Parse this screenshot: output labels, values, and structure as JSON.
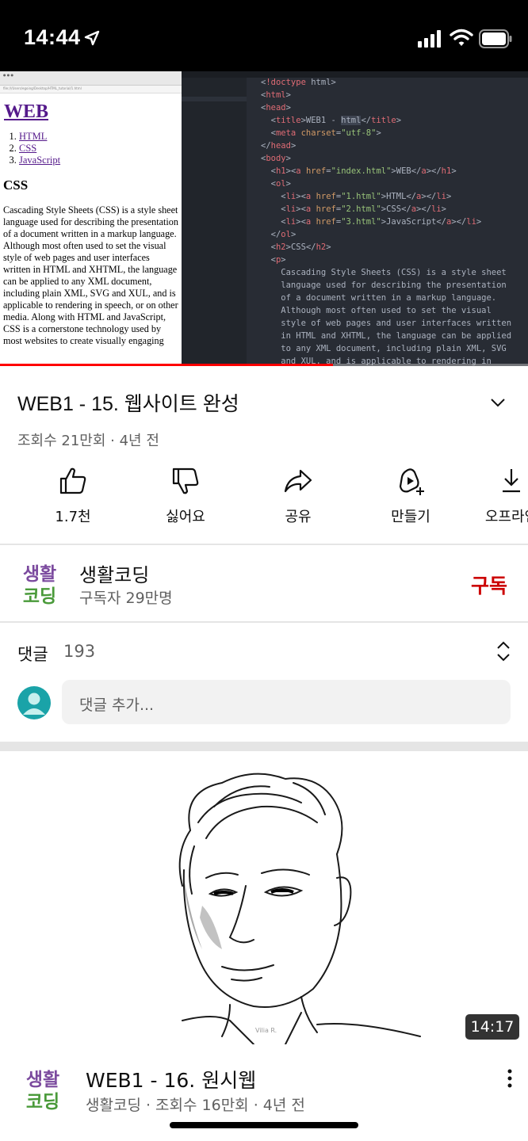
{
  "status_bar": {
    "time": "14:44",
    "icons": [
      "location-arrow-icon",
      "signal-icon",
      "wifi-icon",
      "battery-icon"
    ]
  },
  "video": {
    "browser": {
      "address": "file:///Users/egoing/Desktop/HTML_tutorial/1.html",
      "h1": "WEB",
      "links": [
        "HTML",
        "CSS",
        "JavaScript"
      ],
      "h2": "CSS",
      "paragraph": "Cascading Style Sheets (CSS) is a style sheet language used for describing the presentation of a document written in a markup language. Although most often used to set the visual style of web pages and user interfaces written in HTML and XHTML, the language can be applied to any XML document, including plain XML, SVG and XUL, and is applicable to rendering in speech, or on other media. Along with HTML and JavaScript, CSS is a cornerstone technology used by most websites to create visually engaging"
    },
    "editor_lines": [
      "<!doctype html>",
      "<html>",
      "<head>",
      "  <title>WEB1 - html</title>",
      "  <meta charset=\"utf-8\">",
      "</head>",
      "<body>",
      "  <h1><a href=\"index.html\">WEB</a></h1>",
      "  <ol>",
      "    <li><a href=\"1.html\">HTML</a></li>",
      "    <li><a href=\"2.html\">CSS</a></li>",
      "    <li><a href=\"3.html\">JavaScript</a></li>",
      "  </ol>",
      "  <h2>CSS</h2>",
      "  <p>",
      "    Cascading Style Sheets (CSS) is a style sheet",
      "    language used for describing the presentation",
      "    of a document written in a markup language.",
      "    Although most often used to set the visual",
      "    style of web pages and user interfaces written",
      "    in HTML and XHTML, the language can be applied",
      "    to any XML document, including plain XML, SVG",
      "    and XUL, and is applicable to rendering in"
    ],
    "progress_fraction": 0.63
  },
  "title": {
    "text": "WEB1 - 15. 웹사이트 완성",
    "meta": "조회수 21만회 · 4년 전"
  },
  "actions": [
    {
      "label": "1.7천",
      "icon": "thumbs-up-icon"
    },
    {
      "label": "싫어요",
      "icon": "thumbs-down-icon"
    },
    {
      "label": "공유",
      "icon": "share-icon"
    },
    {
      "label": "만들기",
      "icon": "remix-icon"
    },
    {
      "label": "오프라인",
      "icon": "download-icon"
    }
  ],
  "channel": {
    "name": "생활코딩",
    "subscribers": "구독자 29만명",
    "subscribe_label": "구독",
    "logo_text_top": "생활",
    "logo_text_bottom": "코딩"
  },
  "comments": {
    "label": "댓글",
    "count": "193",
    "placeholder": "댓글 추가..."
  },
  "next_video": {
    "duration": "14:17",
    "title": "WEB1 - 16. 원시웹",
    "meta": "생활코딩 · 조회수 16만회 · 4년 전",
    "thumb_credit": "Vilia R."
  },
  "colors": {
    "subscribe": "#cc0000",
    "progress": "#ff0000",
    "logo_purple": "#7b4a9e",
    "logo_green": "#4a9a3a",
    "logo_orange": "#f08a24"
  }
}
